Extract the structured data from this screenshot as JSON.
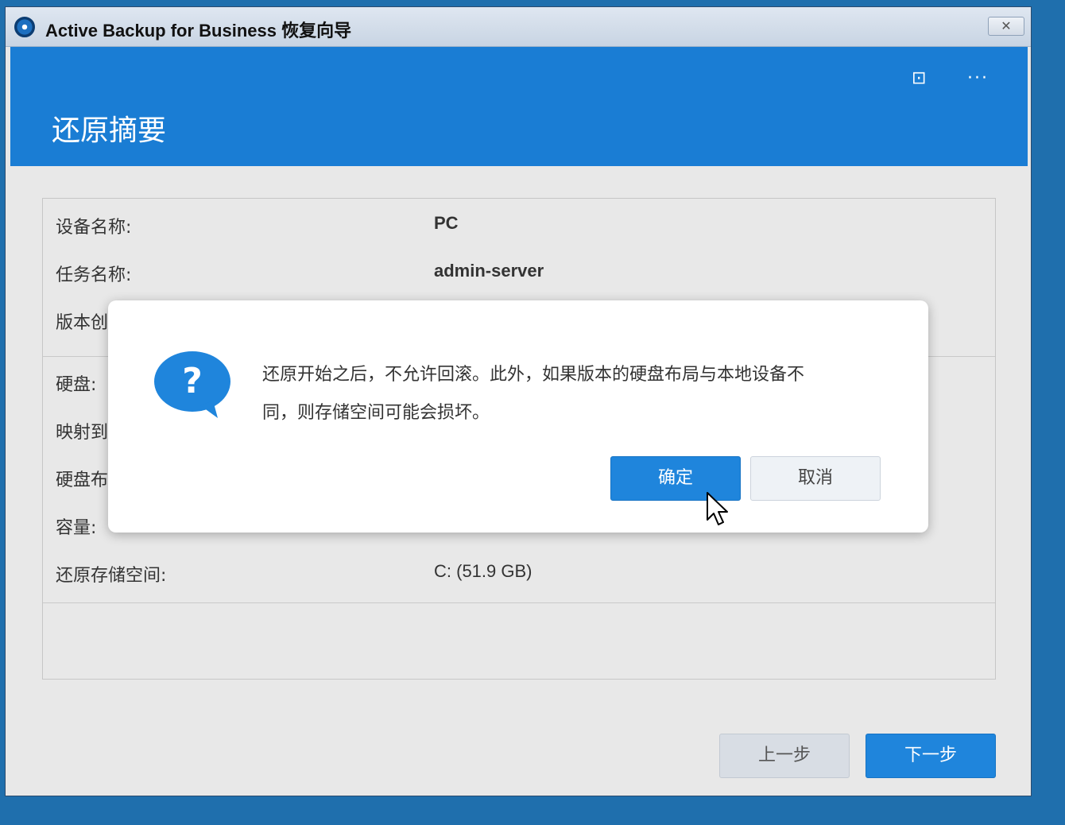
{
  "window": {
    "title": "Active Backup for Business 恢复向导",
    "close_symbol": "✕",
    "icon": "active-backup-logo-icon"
  },
  "header": {
    "page_title": "还原摘要",
    "icons": [
      "display-icon",
      "more-icon"
    ],
    "display_symbol": "⊡",
    "more_symbol": "···",
    "background_color": "#1a7dd4"
  },
  "summary": {
    "rows": [
      {
        "label": "设备名称:",
        "value": "PC"
      },
      {
        "label": "任务名称:",
        "value": "admin-server"
      },
      {
        "label": "版本创",
        "value": ""
      },
      {
        "label": "硬盘:",
        "value": ""
      },
      {
        "label": "映射到",
        "value": ""
      },
      {
        "label": "硬盘布",
        "value": ""
      },
      {
        "label": "容量:",
        "value": ""
      },
      {
        "label": "还原存储空间:",
        "value": "C: (51.9 GB)"
      }
    ]
  },
  "footer": {
    "prev_label": "上一步",
    "next_label": "下一步"
  },
  "dialog": {
    "icon": "question-bubble-icon",
    "icon_symbol": "?",
    "message_line1": "还原开始之后，不允许回滚。此外，如果版本的硬盘布局与本地设备不",
    "message_line2": "同，则存储空间可能会损坏。",
    "ok_label": "确定",
    "cancel_label": "取消"
  },
  "colors": {
    "accent": "#1f85dc",
    "desktop": "#1f6fad"
  }
}
